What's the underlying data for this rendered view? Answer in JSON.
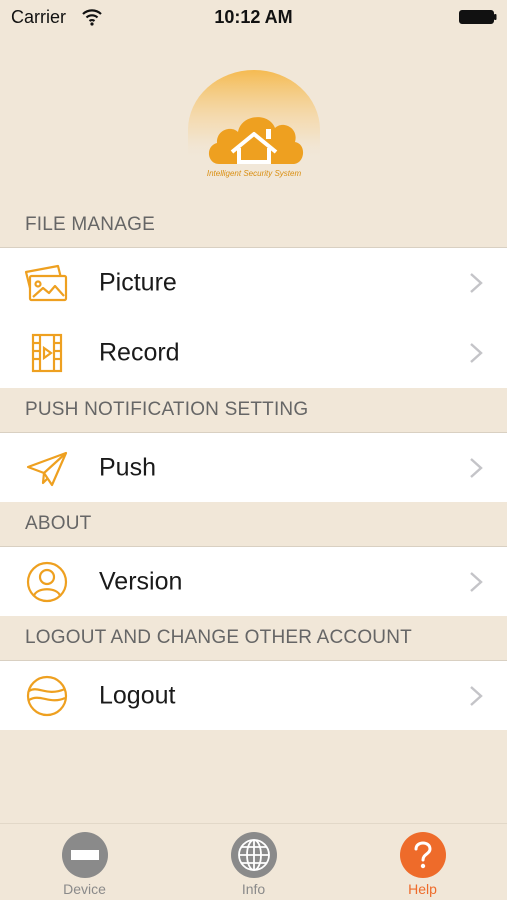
{
  "status_bar": {
    "carrier": "Carrier",
    "time": "10:12 AM"
  },
  "logo": {
    "tagline": "Intelligent Security System",
    "color": "#f0a020"
  },
  "sections": [
    {
      "header": "FILE MANAGE",
      "items": [
        {
          "label": "Picture",
          "icon": "picture-icon"
        },
        {
          "label": "Record",
          "icon": "film-icon"
        }
      ]
    },
    {
      "header": "PUSH  NOTIFICATION SETTING",
      "items": [
        {
          "label": "Push",
          "icon": "paper-plane-icon"
        }
      ]
    },
    {
      "header": "ABOUT",
      "items": [
        {
          "label": "Version",
          "icon": "user-icon"
        }
      ]
    },
    {
      "header": "LOGOUT AND CHANGE OTHER ACCOUNT",
      "items": [
        {
          "label": "Logout",
          "icon": "logout-globe-icon"
        }
      ]
    }
  ],
  "tab_bar": {
    "tabs": [
      {
        "label": "Device",
        "icon": "device-icon",
        "active": false
      },
      {
        "label": "Info",
        "icon": "globe-icon",
        "active": false
      },
      {
        "label": "Help",
        "icon": "question-icon",
        "active": true
      }
    ],
    "active_color": "#ee6b2a",
    "inactive_color": "#8a8a8a"
  },
  "colors": {
    "background": "#f1e7d8",
    "accent": "#f0a020"
  }
}
